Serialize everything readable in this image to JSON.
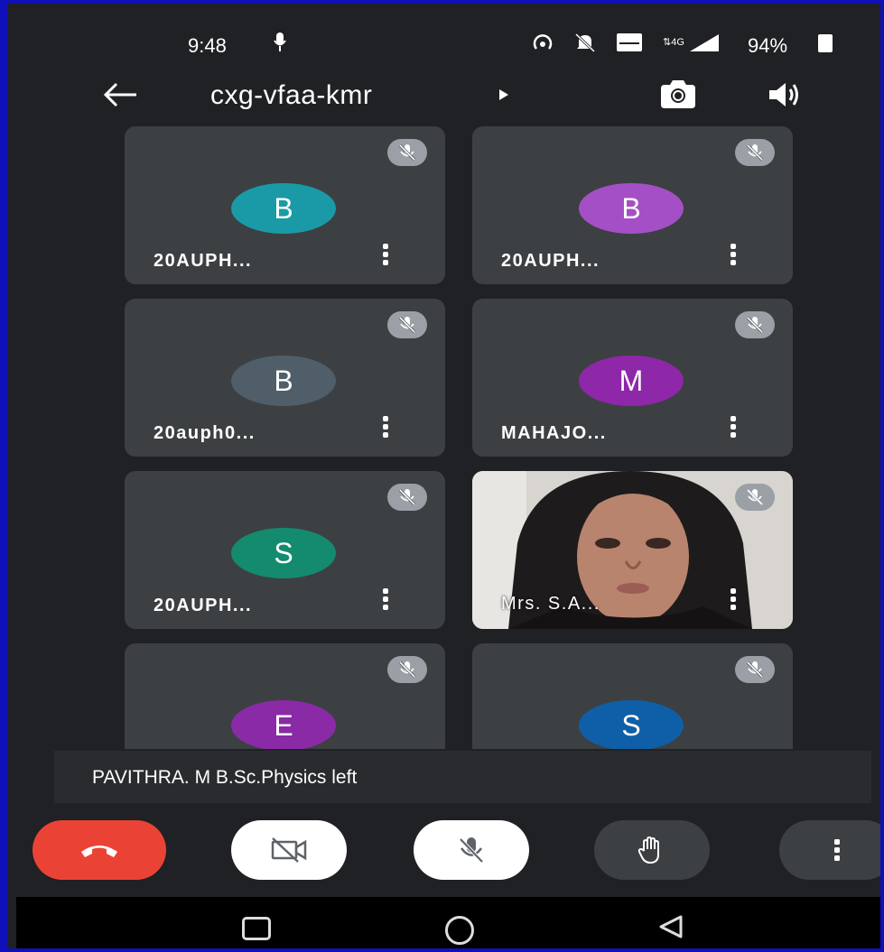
{
  "status_bar": {
    "time": "9:48",
    "battery": "94%"
  },
  "top_bar": {
    "meeting_code": "cxg-vfaa-kmr"
  },
  "participants": [
    {
      "initial": "B",
      "name": "20AUPH...",
      "color": "#1a9aa6"
    },
    {
      "initial": "B",
      "name": "20AUPH...",
      "color": "#a54fc6"
    },
    {
      "initial": "B",
      "name": "20auph0...",
      "color": "#4f5e69"
    },
    {
      "initial": "M",
      "name": "MAHAJO...",
      "color": "#8e27a8"
    },
    {
      "initial": "S",
      "name": "20AUPH...",
      "color": "#148a6f"
    },
    {
      "initial": "",
      "name": "Mrs. S.A...",
      "color": "#000000"
    },
    {
      "initial": "E",
      "name": "",
      "color": "#8a2aa6"
    },
    {
      "initial": "S",
      "name": "",
      "color": "#0f5fa8"
    }
  ],
  "toast": {
    "message": "PAVITHRA. M B.Sc.Physics left"
  },
  "colors": {
    "background": "#202124",
    "tile": "#3c4043",
    "hangup": "#ea4335",
    "frame_border": "#1010b8"
  }
}
